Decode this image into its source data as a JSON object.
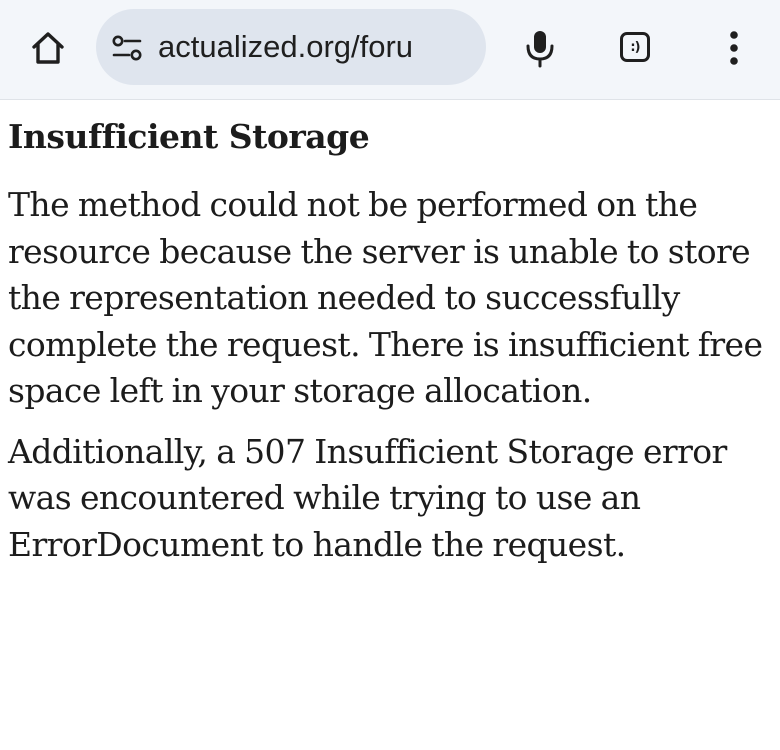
{
  "browser": {
    "url": "actualized.org/foru",
    "tab_count": ":)",
    "icons": {
      "home": "home-icon",
      "site_info": "site-settings-icon",
      "mic": "microphone-icon",
      "tabs": "tab-switcher-icon",
      "menu": "more-vert-icon"
    }
  },
  "page": {
    "title": "Insufficient Storage",
    "paragraphs": [
      "The method could not be performed on the resource because the server is unable to store the representation needed to successfully complete the request. There is insufficient free space left in your storage allocation.",
      "Additionally, a 507 Insufficient Storage error was encountered while trying to use an ErrorDocument to handle the request."
    ]
  }
}
